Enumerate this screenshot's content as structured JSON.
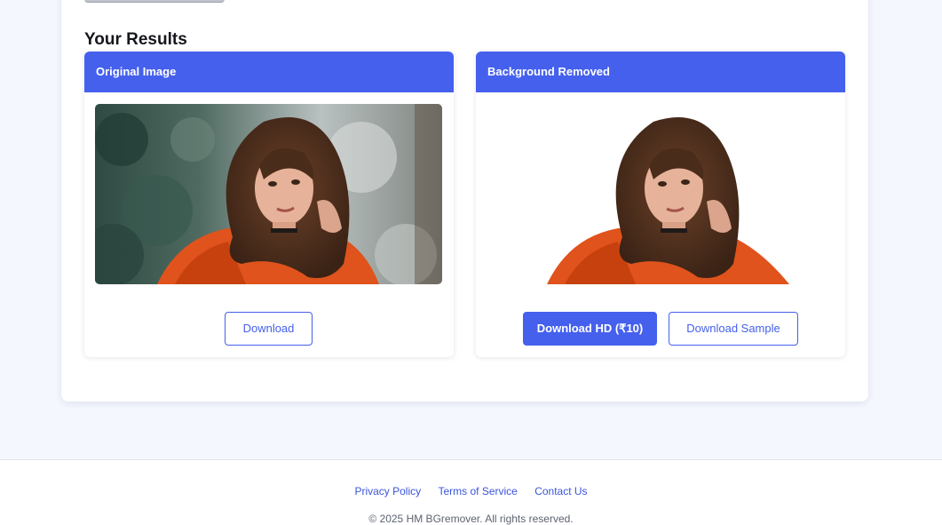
{
  "results": {
    "title": "Your Results",
    "original": {
      "header": "Original Image",
      "download_label": "Download"
    },
    "removed": {
      "header": "Background Removed",
      "download_hd_label": "Download HD (₹10)",
      "download_sample_label": "Download Sample"
    }
  },
  "footer": {
    "links": [
      "Privacy Policy",
      "Terms of Service",
      "Contact Us"
    ],
    "copyright": "© 2025 HM BGremover. All rights reserved."
  },
  "colors": {
    "accent": "#4560ed",
    "page_background": "#f5f7fe"
  }
}
